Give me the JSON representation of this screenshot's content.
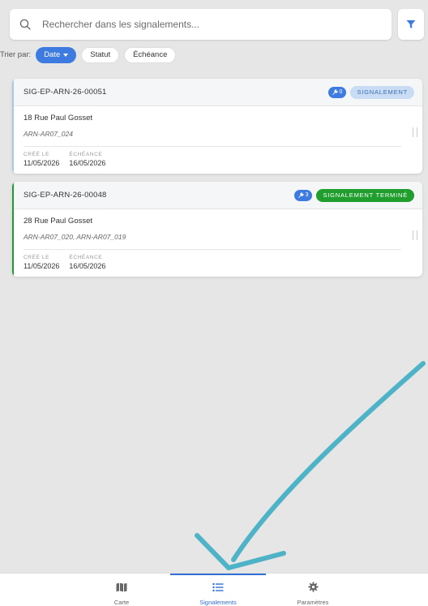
{
  "search": {
    "placeholder": "Rechercher dans les signalements..."
  },
  "sort": {
    "label": "Trier par:",
    "options": [
      {
        "label": "Date",
        "active": true
      },
      {
        "label": "Statut",
        "active": false
      },
      {
        "label": "Échéance",
        "active": false
      }
    ]
  },
  "reports": [
    {
      "id": "SIG-EP-ARN-26-00051",
      "tool_count": "0",
      "status": "SIGNALEMENT",
      "status_color": "#c8dcf3",
      "accent": "#a9c8ee",
      "address": "18 Rue Paul Gosset",
      "refs": "ARN-AR07_024",
      "created_label": "CRÉÉ LE",
      "created": "11/05/2026",
      "due_label": "ÉCHÉANCE",
      "due": "16/05/2026"
    },
    {
      "id": "SIG-EP-ARN-26-00048",
      "tool_count": "3",
      "status": "SIGNALEMENT TERMINÉ",
      "status_color": "#1f9e2d",
      "accent": "#1f9e2d",
      "address": "28 Rue Paul Gosset",
      "refs": "ARN-AR07_020, ARN-AR07_019",
      "created_label": "CRÉÉ LE",
      "created": "11/05/2026",
      "due_label": "ÉCHÉANCE",
      "due": "16/05/2026"
    }
  ],
  "nav": {
    "items": [
      {
        "label": "Carte",
        "icon": "map-icon",
        "active": false
      },
      {
        "label": "Signalements",
        "icon": "list-icon",
        "active": true
      },
      {
        "label": "Paramètres",
        "icon": "gear-icon",
        "active": false
      }
    ]
  },
  "colors": {
    "accent": "#3d7be0",
    "arrow": "#4fb3c8"
  }
}
